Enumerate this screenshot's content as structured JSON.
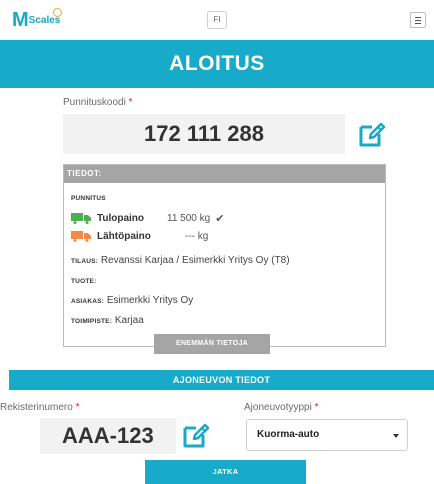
{
  "app": {
    "logo_text": "Scales",
    "logo_letter": "M",
    "language_button": "FI"
  },
  "header": {
    "title": "ALOITUS"
  },
  "weighing_code": {
    "label": "Punnituskoodi",
    "required_mark": "*",
    "value": "172 111 288"
  },
  "details": {
    "heading": "TIEDOT:",
    "weighing_heading": "PUNNITUS",
    "arrival": {
      "label": "Tulopaino",
      "value": "11 500 kg",
      "status": "✔",
      "icon": "truck-green-icon",
      "color": "#4caf50"
    },
    "departure": {
      "label": "Lähtöpaino",
      "value": "--- kg",
      "icon": "truck-orange-icon",
      "color": "#f28c45"
    },
    "order": {
      "key": "TILAUS:",
      "value": "Revanssi Karjaa / Esimerkki Yritys Oy (T8)"
    },
    "product": {
      "key": "TUOTE:",
      "value": ""
    },
    "customer": {
      "key": "ASIAKAS:",
      "value": "Esimerkki Yritys Oy"
    },
    "office": {
      "key": "TOIMIPISTE:",
      "value": "Karjaa"
    },
    "more_button": "ENEMMÄN TIETOJA"
  },
  "vehicle": {
    "heading": "AJONEUVON TIEDOT",
    "reg_label": "Rekisterinumero",
    "reg_value": "AAA-123",
    "type_label": "Ajoneuvotyyppi",
    "type_value": "Kuorma-auto",
    "required_mark": "*"
  },
  "actions": {
    "continue": "JATKA"
  },
  "colors": {
    "accent": "#17aac9",
    "panel_header": "#a5a5a5",
    "required": "#d32020"
  }
}
